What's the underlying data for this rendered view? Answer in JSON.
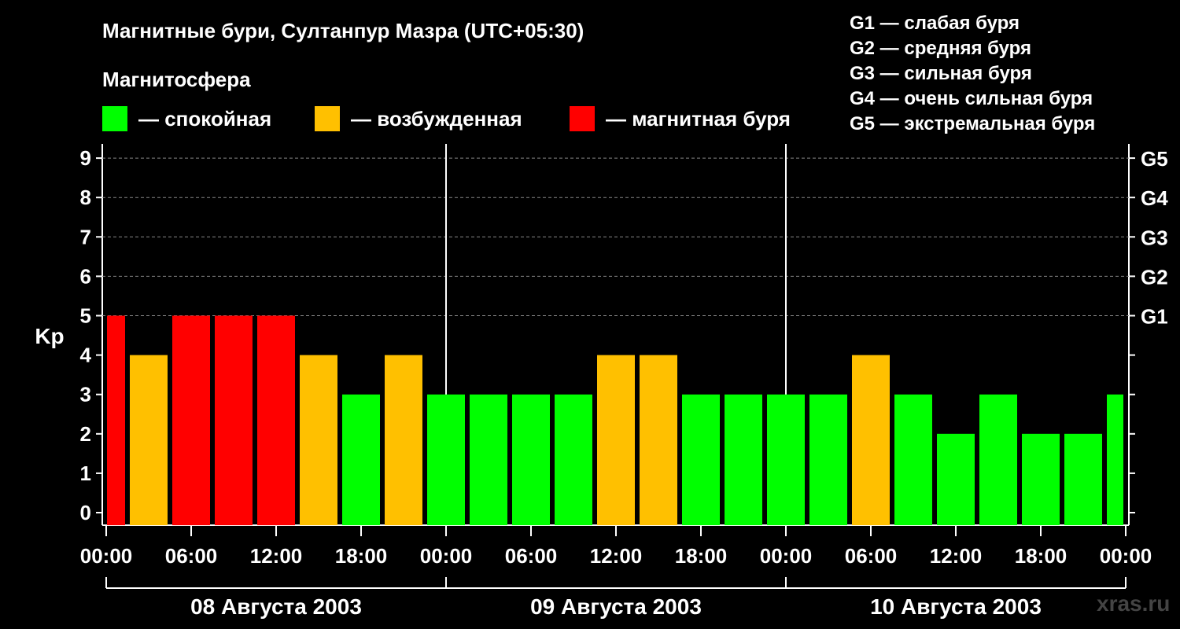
{
  "title": "Магнитные бури, Султанпур Мазра (UTC+05:30)",
  "subtitle": "Магнитосфера",
  "legend": [
    {
      "label": "— спокойная",
      "color": "#00ff00"
    },
    {
      "label": "— возбужденная",
      "color": "#ffc000"
    },
    {
      "label": "— магнитная буря",
      "color": "#ff0000"
    }
  ],
  "g_legend": [
    "G1 — слабая буря",
    "G2 — средняя буря",
    "G3 — сильная буря",
    "G4 — очень сильная буря",
    "G5 — экстремальная буря"
  ],
  "watermark": "xras.ru",
  "chart_data": {
    "type": "bar",
    "ylabel": "Kp",
    "ylim": [
      0,
      9
    ],
    "yticks": [
      "0",
      "1",
      "2",
      "3",
      "4",
      "5",
      "6",
      "7",
      "8",
      "9"
    ],
    "y2ticks": [
      {
        "value": 5,
        "label": "G1"
      },
      {
        "value": 6,
        "label": "G2"
      },
      {
        "value": 7,
        "label": "G3"
      },
      {
        "value": 8,
        "label": "G4"
      },
      {
        "value": 9,
        "label": "G5"
      }
    ],
    "xticks": [
      "00:00",
      "06:00",
      "12:00",
      "18:00",
      "00:00",
      "06:00",
      "12:00",
      "18:00",
      "00:00",
      "06:00",
      "12:00",
      "18:00",
      "00:00"
    ],
    "days": [
      "08 Августа 2003",
      "09 Августа 2003",
      "10 Августа 2003"
    ],
    "colors": {
      "quiet": "#00ff00",
      "active": "#ffc000",
      "storm": "#ff0000"
    },
    "first_bar_partial": true,
    "last_bar_partial": true,
    "values": [
      5,
      4,
      5,
      5,
      5,
      4,
      3,
      4,
      3,
      3,
      3,
      3,
      4,
      4,
      3,
      3,
      3,
      3,
      4,
      3,
      2,
      3,
      2,
      2,
      3
    ],
    "grid": true
  }
}
